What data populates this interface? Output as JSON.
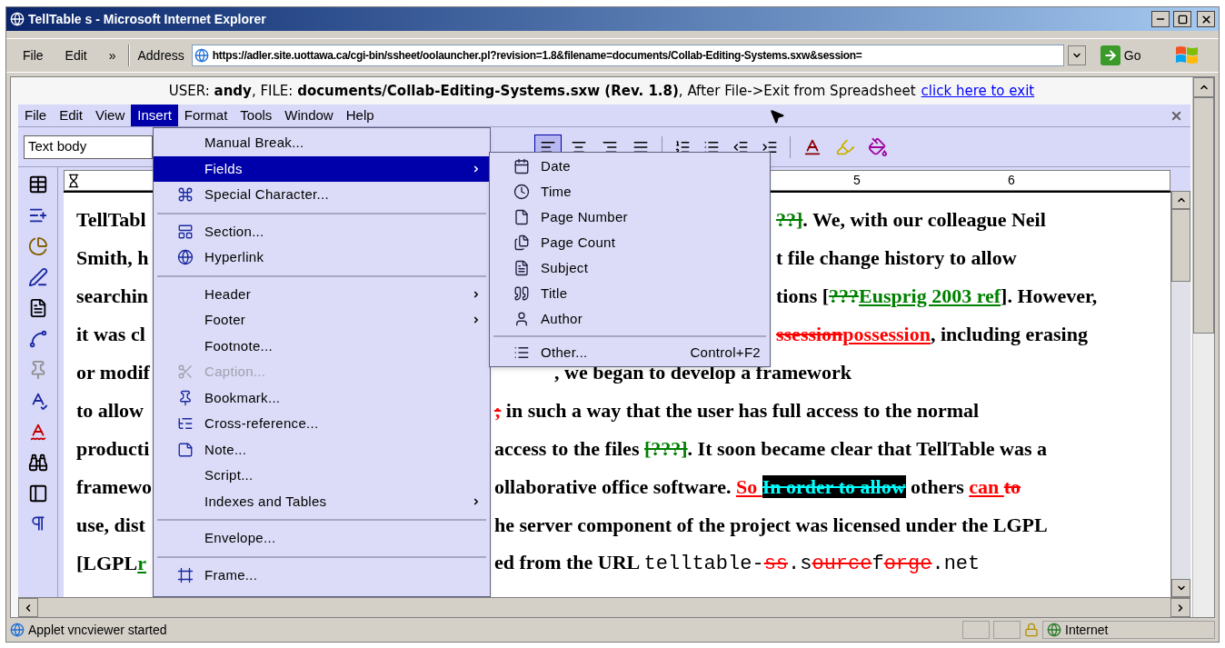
{
  "window": {
    "title": "TellTable s - Microsoft Internet Explorer"
  },
  "ie_menu": [
    "File",
    "Edit",
    "»"
  ],
  "address": {
    "label": "Address",
    "value": "https://adler.site.uottawa.ca/cgi-bin/ssheet/oolauncher.pl?revision=1.8&filename=documents/Collab-Editing-Systems.sxw&session="
  },
  "go_button": "Go",
  "session_bar": {
    "text": "USER: **andy**, FILE: **documents/Collab-Editing-Systems.sxw (Rev. 1.8)**, After File->Exit from Spreadsheet",
    "link": "click here to exit"
  },
  "menubar": [
    {
      "label": "File",
      "selected": false
    },
    {
      "label": "Edit",
      "selected": false
    },
    {
      "label": "View",
      "selected": false
    },
    {
      "label": "Insert",
      "selected": true
    },
    {
      "label": "Format",
      "selected": false
    },
    {
      "label": "Tools",
      "selected": false
    },
    {
      "label": "Window",
      "selected": false
    },
    {
      "label": "Help",
      "selected": false
    }
  ],
  "style_box": {
    "value": "Text body"
  },
  "alignment": [
    {
      "selected": true
    },
    {
      "selected": false
    },
    {
      "selected": false
    },
    {
      "selected": false
    }
  ],
  "ruler": [
    "5",
    "6"
  ],
  "insert_menu": [
    {
      "kind": "item",
      "label": "Manual Break...",
      "submenu": false,
      "selected": false,
      "disabled": false
    },
    {
      "kind": "item",
      "label": "Fields",
      "submenu": true,
      "selected": true,
      "disabled": false
    },
    {
      "kind": "item",
      "label": "Special Character...",
      "submenu": false,
      "selected": false,
      "disabled": false
    },
    {
      "kind": "separator"
    },
    {
      "kind": "item",
      "label": "Section...",
      "submenu": false,
      "selected": false,
      "disabled": false
    },
    {
      "kind": "item",
      "label": "Hyperlink",
      "submenu": false,
      "selected": false,
      "disabled": false
    },
    {
      "kind": "separator"
    },
    {
      "kind": "item",
      "label": "Header",
      "submenu": true,
      "selected": false,
      "disabled": false
    },
    {
      "kind": "item",
      "label": "Footer",
      "submenu": true,
      "selected": false,
      "disabled": false
    },
    {
      "kind": "item",
      "label": "Footnote...",
      "submenu": false,
      "selected": false,
      "disabled": false
    },
    {
      "kind": "item",
      "label": "Caption...",
      "submenu": false,
      "selected": false,
      "disabled": true
    },
    {
      "kind": "item",
      "label": "Bookmark...",
      "submenu": false,
      "selected": false,
      "disabled": false
    },
    {
      "kind": "item",
      "label": "Cross-reference...",
      "submenu": false,
      "selected": false,
      "disabled": false
    },
    {
      "kind": "item",
      "label": "Note...",
      "submenu": false,
      "selected": false,
      "disabled": false
    },
    {
      "kind": "item",
      "label": "Script...",
      "submenu": false,
      "selected": false,
      "disabled": false
    },
    {
      "kind": "item",
      "label": "Indexes and Tables",
      "submenu": true,
      "selected": false,
      "disabled": false
    },
    {
      "kind": "separator"
    },
    {
      "kind": "item",
      "label": "Envelope...",
      "submenu": false,
      "selected": false,
      "disabled": false
    },
    {
      "kind": "separator"
    },
    {
      "kind": "item",
      "label": "Frame...",
      "submenu": false,
      "selected": false,
      "disabled": false
    }
  ],
  "fields_menu": [
    {
      "kind": "item",
      "label": "Date"
    },
    {
      "kind": "item",
      "label": "Time"
    },
    {
      "kind": "item",
      "label": "Page Number"
    },
    {
      "kind": "item",
      "label": "Page Count"
    },
    {
      "kind": "item",
      "label": "Subject"
    },
    {
      "kind": "item",
      "label": "Title"
    },
    {
      "kind": "item",
      "label": "Author"
    },
    {
      "kind": "separator"
    },
    {
      "kind": "item",
      "label": "Other...",
      "shortcut": "Control+F2"
    }
  ],
  "document": {
    "lines": [
      {
        "left": [
          {
            "text": "TellTabl",
            "kind": "plain"
          }
        ],
        "right": [
          {
            "text": "??]",
            "kind": "delete",
            "color": "#008000"
          },
          {
            "text": ". We, with our colleague Neil",
            "kind": "plain"
          }
        ]
      },
      {
        "left": [
          {
            "text": "Smith, h",
            "kind": "plain"
          }
        ],
        "right": [
          {
            "text": "t file change history to allow",
            "kind": "plain"
          }
        ]
      },
      {
        "left": [
          {
            "text": "searchin",
            "kind": "plain"
          }
        ],
        "right": [
          {
            "text": "tions [",
            "kind": "plain"
          },
          {
            "text": "???",
            "kind": "delete",
            "color": "#008000"
          },
          {
            "text": "Eusprig 2003 ref",
            "kind": "insert",
            "color": "#008000"
          },
          {
            "text": "]. However,",
            "kind": "plain"
          }
        ]
      },
      {
        "left": [
          {
            "text": "it was cl",
            "kind": "plain"
          }
        ],
        "right": [
          {
            "text": "ssession",
            "kind": "delete",
            "color": "#ff0000"
          },
          {
            "text": "possession",
            "kind": "insert",
            "color": "#ff0000"
          },
          {
            "text": ", including erasing",
            "kind": "plain"
          }
        ]
      },
      {
        "left": [
          {
            "text": "or modif",
            "kind": "plain"
          }
        ],
        "right": [
          {
            "text": ", we began to develop a framework",
            "kind": "plain"
          }
        ]
      },
      {
        "left": [
          {
            "text": "to allow",
            "kind": "plain"
          }
        ],
        "right": [
          {
            "text": ";",
            "kind": "delete",
            "color": "#ff0000"
          },
          {
            "text": " in such a way that the user has full access to the normal",
            "kind": "plain"
          }
        ]
      },
      {
        "left": [
          {
            "text": "producti",
            "kind": "plain"
          }
        ],
        "right": [
          {
            "text": "access to the files ",
            "kind": "plain"
          },
          {
            "text": "[???]",
            "kind": "delete",
            "color": "#008000"
          },
          {
            "text": ". It soon became clear that TellTable was a",
            "kind": "plain"
          }
        ]
      },
      {
        "left": [
          {
            "text": "framewo",
            "kind": "plain"
          }
        ],
        "right": [
          {
            "text": "ollaborative office software. ",
            "kind": "plain"
          },
          {
            "text": "So ",
            "kind": "insert",
            "color": "#ff0000"
          },
          {
            "text": "In order to allow",
            "kind": "selection"
          },
          {
            "text": " others ",
            "kind": "plain"
          },
          {
            "text": "can ",
            "kind": "insert",
            "color": "#ff0000"
          },
          {
            "text": "to",
            "kind": "delete",
            "color": "#ff0000"
          }
        ]
      },
      {
        "left": [
          {
            "text": "use, dist",
            "kind": "plain"
          }
        ],
        "right": [
          {
            "text": "he server component of the project was licensed under the LGPL",
            "kind": "plain"
          }
        ]
      },
      {
        "left": [
          {
            "text": "[LGPL",
            "kind": "plain"
          },
          {
            "text": "r",
            "kind": "insert",
            "color": "#008000"
          }
        ],
        "right": [
          {
            "text": "ed from the URL ",
            "kind": "plain"
          },
          {
            "text": "telltable-",
            "kind": "plain",
            "mono": true
          },
          {
            "text": "ss",
            "kind": "delete",
            "color": "#ff0000",
            "mono": true
          },
          {
            "text": ".s",
            "kind": "plain",
            "mono": true
          },
          {
            "text": "ource",
            "kind": "delete",
            "color": "#ff0000",
            "mono": true
          },
          {
            "text": "f",
            "kind": "plain",
            "mono": true
          },
          {
            "text": "orge",
            "kind": "delete",
            "color": "#ff0000",
            "mono": true
          },
          {
            "text": ".net",
            "kind": "plain",
            "mono": true
          }
        ]
      }
    ]
  },
  "status_bar": {
    "message": "Applet vncviewer started",
    "zone": "Internet"
  }
}
